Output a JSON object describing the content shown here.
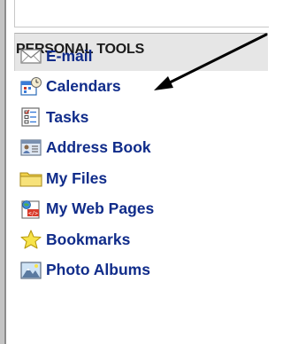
{
  "section": {
    "title": "PERSONAL TOOLS"
  },
  "menu": {
    "items": [
      {
        "label": "E-mail",
        "icon": "envelope-icon"
      },
      {
        "label": "Calendars",
        "icon": "calendar-icon"
      },
      {
        "label": "Tasks",
        "icon": "tasks-icon"
      },
      {
        "label": "Address Book",
        "icon": "address-book-icon"
      },
      {
        "label": "My Files",
        "icon": "folder-icon"
      },
      {
        "label": "My Web Pages",
        "icon": "web-page-icon"
      },
      {
        "label": "Bookmarks",
        "icon": "star-icon"
      },
      {
        "label": "Photo Albums",
        "icon": "photo-icon"
      }
    ]
  },
  "colors": {
    "link": "#102c8a",
    "header_bg": "#e6e6e6",
    "header_text": "#1b1b1b",
    "arrow": "#000000"
  }
}
